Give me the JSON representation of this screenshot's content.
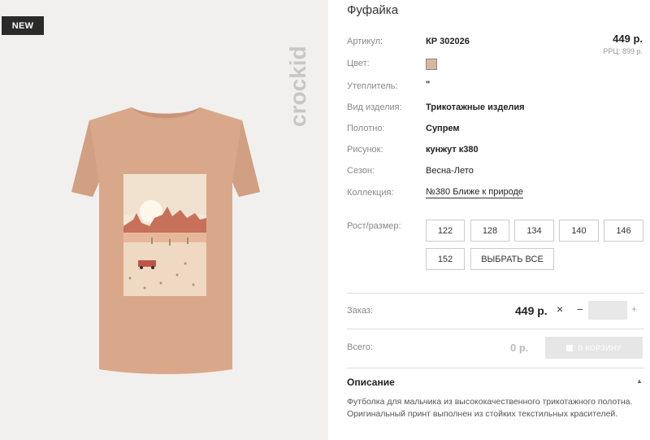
{
  "badge": "NEW",
  "brand": "crockid",
  "product": {
    "title": "Фуфайка",
    "price": "449 р.",
    "rrp": "РРЦ: 899 р."
  },
  "attributes": {
    "article_label": "Артикул:",
    "article_value": "КР 302026",
    "color_label": "Цвет:",
    "color_hex": "#d6b99a",
    "insulation_label": "Утеплитель:",
    "insulation_value": "\"",
    "type_label": "Вид изделия:",
    "type_value": "Трикотажные изделия",
    "fabric_label": "Полотно:",
    "fabric_value": "Супрем",
    "print_label": "Рисунок:",
    "print_value": "кунжут к380",
    "season_label": "Сезон:",
    "season_value": "Весна-Лето",
    "collection_label": "Коллекция:",
    "collection_value": "№380 Ближе к природе"
  },
  "sizes": {
    "label": "Рост/размер:",
    "options": [
      "122",
      "128",
      "134",
      "140",
      "146",
      "152"
    ],
    "select_all": "ВЫБРАТЬ ВСЕ"
  },
  "order": {
    "label": "Заказ:",
    "price": "449 р.",
    "close": "×",
    "minus": "−",
    "plus": "+",
    "quantity": ""
  },
  "total": {
    "label": "Всего:",
    "value": "0 р.",
    "cart_button": "В КОРЗИНУ"
  },
  "description": {
    "title": "Описание",
    "text": "Футболка для мальчика из высококачественного трикотажного полотна. Оригинальный принт выполнен из стойких текстильных красителей."
  },
  "icons": {
    "close": "close-icon",
    "cart": "cart-icon",
    "collapse": "chevron-up-icon"
  }
}
